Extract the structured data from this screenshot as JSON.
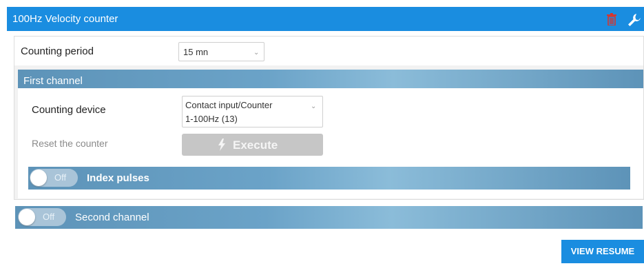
{
  "header": {
    "title": "100Hz Velocity counter",
    "icons": [
      "trash-icon",
      "wrench-icon"
    ]
  },
  "counting_period": {
    "label": "Counting period",
    "value": "15 mn"
  },
  "first_channel": {
    "title": "First channel",
    "counting_device": {
      "label": "Counting device",
      "value_line1": "Contact input/Counter",
      "value_line2": "1-100Hz (13)"
    },
    "reset": {
      "label": "Reset the counter",
      "button": "Execute"
    },
    "index_pulses": {
      "toggle": "Off",
      "label": "Index pulses"
    }
  },
  "second_channel": {
    "toggle": "Off",
    "label": "Second channel"
  },
  "view_resume": "VIEW RESUME",
  "colors": {
    "accent": "#1a8de0",
    "bar": "#6ba3c8",
    "trash": "#d9342b"
  }
}
